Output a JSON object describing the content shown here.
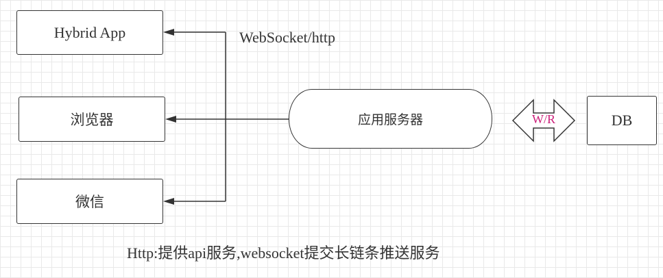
{
  "nodes": {
    "hybrid_app": "Hybrid App",
    "browser": "浏览器",
    "wechat": "微信",
    "app_server": "应用服务器",
    "db": "DB"
  },
  "edges": {
    "protocol_label": "WebSocket/http",
    "db_link_label": "W/R"
  },
  "caption": "Http:提供api服务,websocket提交长链条推送服务",
  "colors": {
    "stroke": "#333333",
    "wr_text": "#cc1f7a",
    "grid": "#e9e9e9"
  }
}
